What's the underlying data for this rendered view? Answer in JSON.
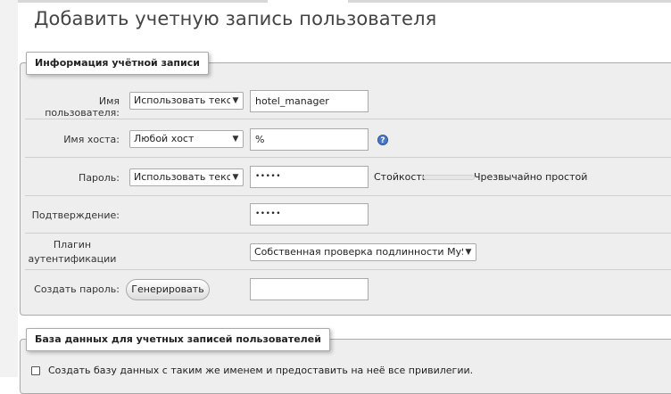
{
  "page_title": "Добавить учетную запись пользователя",
  "account_section": {
    "legend": "Информация учётной записи",
    "username": {
      "label": "Имя пользователя:",
      "mode_select": "Использовать текстовое поле",
      "value": "hotel_manager"
    },
    "hostname": {
      "label": "Имя хоста:",
      "host_select": "Любой хост",
      "value": "%",
      "help_icon": "help-icon"
    },
    "password": {
      "label": "Пароль:",
      "mode_select": "Использовать текстовое поле",
      "value": "•••••",
      "strength_label": "Стойкость:",
      "strength_text": "Чрезвычайно простой",
      "strength_level": 0.0
    },
    "confirm": {
      "label": "Подтверждение:",
      "value": "•••••"
    },
    "auth_plugin": {
      "label_line1": "Плагин",
      "label_line2": "аутентификации",
      "select": "Собственная проверка подлинности MySQL"
    },
    "generate": {
      "label": "Создать пароль:",
      "button": "Генерировать",
      "value": ""
    }
  },
  "database_section": {
    "legend": "База данных для учетных записей пользователей",
    "create_db_option": {
      "label": "Создать базу данных с таким же именем и предоставить на неё все привилегии.",
      "checked": false
    }
  },
  "colors": {
    "fieldset_bg": "#eeeeee",
    "help_icon": "#4a78c8"
  }
}
